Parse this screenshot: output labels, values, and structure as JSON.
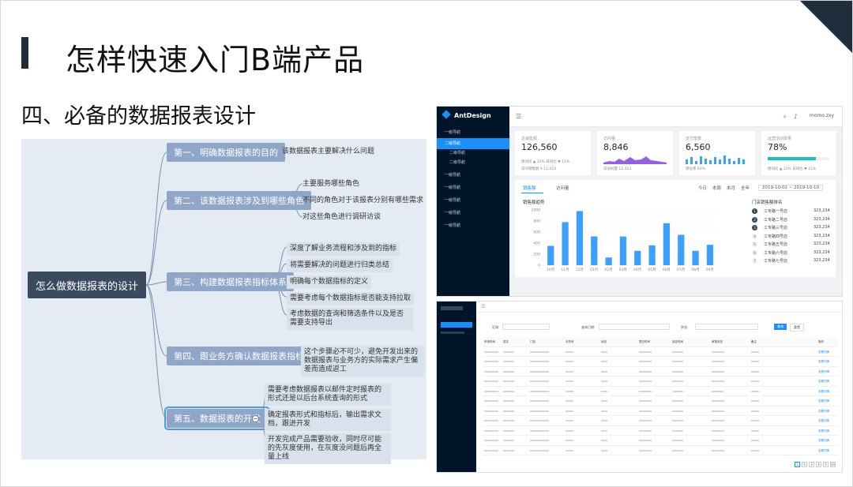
{
  "slide": {
    "title": "怎样快速入门B端产品",
    "subtitle": "四、必备的数据报表设计"
  },
  "mindmap": {
    "root": "怎么做数据报表的设计",
    "branches": [
      {
        "label": "第一、明确数据报表的目的",
        "items": [
          "该数据报表主要解决什么问题"
        ]
      },
      {
        "label": "第二、该数据报表涉及到哪些角色",
        "items": [
          "主要服务哪些角色",
          "不同的角色对于该报表分别有哪些需求",
          "对这些角色进行调研访谈"
        ]
      },
      {
        "label": "第三、构建数据报表指标体系",
        "items": [
          "深度了解业务流程和涉及到的指标",
          "将需要解决的问题进行归类总结",
          "明确每个数据指标的定义",
          "需要考虑每个数据指标是否能支持拉取",
          "考虑数据的查询和筛选条件以及是否需要支持导出"
        ]
      },
      {
        "label": "第四、跟业务方确认数据报表指标",
        "items": [
          "这个步骤必不可少，避免开发出来的数据报表与业务方的实际需求产生偏差而造成返工"
        ]
      },
      {
        "label": "第五、数据报表的开发",
        "items": [
          "需要考虑数据报表以邮件定时报表的形式还是以后台系统查询的形式",
          "确定报表形式和指标后，输出需求文档，跟进开发",
          "开发完成产品需要验收，同时尽可能的先灰度使用，在灰度没问题后再全量上线"
        ]
      }
    ]
  },
  "dashboard": {
    "brand": "AntDesign",
    "user": "momo.zxy",
    "nav": [
      "一级导航",
      "二级导航",
      "二级导航",
      "二级导航",
      "一级导航",
      "一级导航",
      "一级导航",
      "一级导航",
      "一级导航",
      "一级导航"
    ],
    "cards": [
      {
        "label": "总销售额",
        "value": "126,560",
        "foot": "周同比 ▲ 12%   日同比 ▼ 11%",
        "foot2": "日均销售额 ¥ 12,423"
      },
      {
        "label": "访问量",
        "value": "8,846",
        "foot": "日访问量 12,423"
      },
      {
        "label": "支付笔数",
        "value": "6,560",
        "foot": "转化率 60%"
      },
      {
        "label": "运营活动效果",
        "value": "78%",
        "foot": "周同比 ▲ 12%   日同比 ▼ 11%"
      }
    ],
    "tabs": [
      "销售额",
      "访问量"
    ],
    "period_tabs": [
      "今日",
      "本周",
      "本月",
      "全年"
    ],
    "date_range": "2019-10-02 ~ 2019-10-10",
    "chart_title": "销售额趋势",
    "ranking_title": "门店销售额排名",
    "ranking": [
      {
        "rank": "1",
        "name": "工专路一号店",
        "value": "323,234"
      },
      {
        "rank": "2",
        "name": "工专路二号店",
        "value": "323,234"
      },
      {
        "rank": "3",
        "name": "工专路三号店",
        "value": "323,234"
      },
      {
        "rank": "4",
        "name": "工专路四号店",
        "value": "323,234"
      },
      {
        "rank": "5",
        "name": "工专路五号店",
        "value": "323,234"
      },
      {
        "rank": "6",
        "name": "工专路六号店",
        "value": "323,234"
      },
      {
        "rank": "7",
        "name": "工专路七号店",
        "value": "323,234"
      }
    ]
  },
  "chart_data": {
    "type": "bar",
    "title": "销售额趋势",
    "categories": [
      "10月",
      "11月",
      "12月",
      "01月",
      "02月",
      "03月",
      "04月",
      "05月",
      "06月",
      "07月",
      "08月",
      "09月"
    ],
    "values": [
      350,
      780,
      980,
      520,
      140,
      520,
      260,
      360,
      760,
      550,
      260,
      370
    ],
    "yticks": [
      "1000",
      "800",
      "600",
      "400",
      "200",
      "0"
    ],
    "ylim": [
      0,
      1000
    ],
    "color": "#3ba0ff"
  },
  "table_page": {
    "buttons": [
      "查询",
      "重置"
    ],
    "filter_labels": [
      "区域:",
      "查询日期:",
      "状态:"
    ],
    "headers": [
      "申请时间",
      "姓名",
      "门店",
      "手机号",
      "状态",
      "提交时间",
      "到店时间",
      "审核状态",
      "备注",
      "操作"
    ],
    "action": "查看详情",
    "pages": [
      "1",
      "2",
      "3",
      "4",
      "5",
      "50"
    ]
  }
}
